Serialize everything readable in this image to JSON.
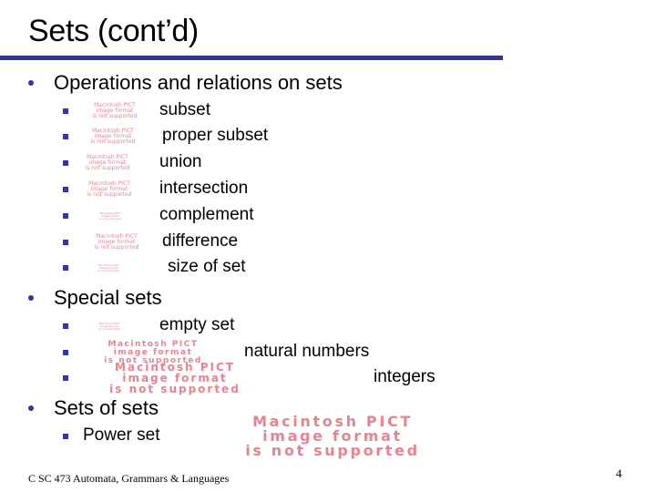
{
  "slide": {
    "title": "Sets (cont’d)",
    "accent_color": "#3333aa",
    "placeholder_color": "#e05a6a",
    "sections": [
      {
        "label": "Operations and relations on sets",
        "items": [
          {
            "label": "subset",
            "image": "Macintosh PICT image format is not supported"
          },
          {
            "label": "proper subset",
            "image": "Macintosh PICT image format is not supported"
          },
          {
            "label": "union",
            "image": "Macintosh PICT image format is not supported"
          },
          {
            "label": "intersection",
            "image": "Macintosh PICT image format is not supported"
          },
          {
            "label": "complement",
            "image": "Macintosh PICT image format is not supported"
          },
          {
            "label": "difference",
            "image": "Macintosh PICT image format is not supported"
          },
          {
            "label": "size of set",
            "image": "Macintosh PICT image format is not supported"
          }
        ]
      },
      {
        "label": "Special sets",
        "items": [
          {
            "label": "empty set",
            "image": "Macintosh PICT image format is not supported"
          },
          {
            "label": "natural numbers",
            "image": "Macintosh PICT image format is not supported"
          },
          {
            "label": "integers",
            "image": "Macintosh PICT image format is not supported"
          }
        ]
      },
      {
        "label": "Sets of sets",
        "items": [
          {
            "label": "Power set",
            "image": "Macintosh PICT image format is not supported"
          }
        ]
      }
    ],
    "pict_lines": [
      "Macintosh PICT",
      "image format",
      "is not supported"
    ],
    "footer": "C SC 473 Automata, Grammars & Languages",
    "page_number": "4"
  }
}
